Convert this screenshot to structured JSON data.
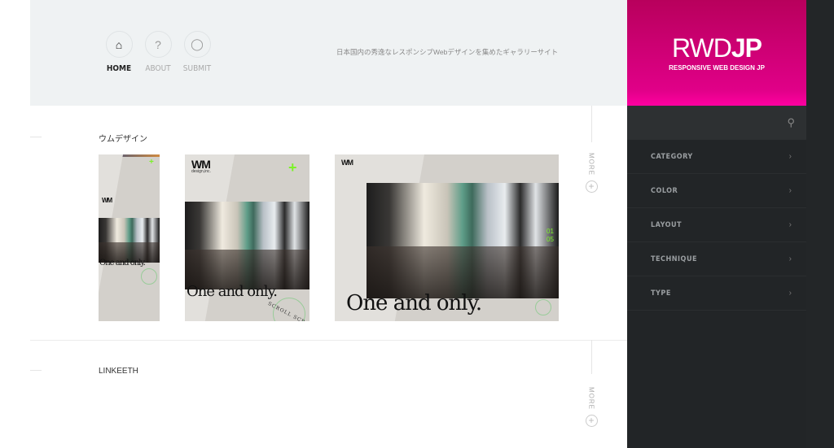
{
  "nav": [
    {
      "label": "HOME",
      "icon": "home-icon"
    },
    {
      "label": "ABOUT",
      "icon": "question-icon"
    },
    {
      "label": "SUBMIT",
      "icon": "speech-bubble-icon"
    }
  ],
  "tagline": "日本国内の秀逸なレスポンシブWebデザインを集めたギャラリーサイト",
  "sections": [
    {
      "title": "ウムデザイン",
      "more": "MORE",
      "thumb_logo": "WM",
      "thumb_logo_sub": "design,inc.",
      "thumb_headline": "One and only.",
      "thumb_scroll": "SCROLL SCROLL",
      "thumb_counter": "01 05"
    },
    {
      "title": "LINKEETH",
      "more": "MORE"
    }
  ],
  "brand": {
    "title_light": "RWD",
    "title_bold": "JP",
    "subtitle": "RESPONSIVE WEB DESIGN JP",
    "color": "#e0007f"
  },
  "sidebar": {
    "search_icon": "search-icon",
    "items": [
      {
        "label": "CATEGORY"
      },
      {
        "label": "COLOR"
      },
      {
        "label": "LAYOUT"
      },
      {
        "label": "TECHNIQUE"
      },
      {
        "label": "TYPE"
      }
    ]
  }
}
